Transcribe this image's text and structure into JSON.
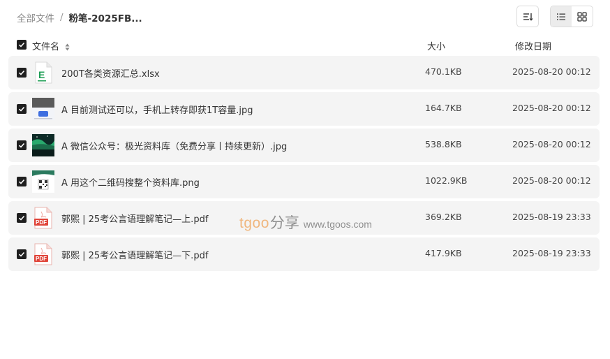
{
  "breadcrumb": {
    "root": "全部文件",
    "separator": "/",
    "current": "粉笔-2025FB..."
  },
  "toolbar": {
    "sort_icon": "sort-icon",
    "list_view_icon": "list-view-icon",
    "grid_view_icon": "grid-view-icon",
    "active_view": "list"
  },
  "table": {
    "headers": {
      "name": "文件名",
      "size": "大小",
      "date": "修改日期"
    },
    "rows": [
      {
        "name": "200T各类资源汇总.xlsx",
        "size": "470.1KB",
        "date": "2025-08-20 00:12",
        "icon": "excel-file-icon",
        "checked": true
      },
      {
        "name": "A 目前测试还可以，手机上转存即获1T容量.jpg",
        "size": "164.7KB",
        "date": "2025-08-20 00:12",
        "icon": "image-thumbnail",
        "checked": true
      },
      {
        "name": "A 微信公众号：极光资料库（免费分享丨持续更新）.jpg",
        "size": "538.8KB",
        "date": "2025-08-20 00:12",
        "icon": "image-thumbnail",
        "checked": true
      },
      {
        "name": "A 用这个二维码搜整个资料库.png",
        "size": "1022.9KB",
        "date": "2025-08-20 00:12",
        "icon": "qr-image-thumbnail",
        "checked": true
      },
      {
        "name": "郭熙 | 25考公言语理解笔记—上.pdf",
        "size": "369.2KB",
        "date": "2025-08-19 23:33",
        "icon": "pdf-file-icon",
        "checked": true
      },
      {
        "name": "郭熙 | 25考公言语理解笔记—下.pdf",
        "size": "417.9KB",
        "date": "2025-08-19 23:33",
        "icon": "pdf-file-icon",
        "checked": true
      }
    ]
  },
  "file_icons": {
    "excel_letter": "E",
    "pdf_label": "PDF"
  },
  "watermark": {
    "brand": "tgoo",
    "cn": "分享",
    "url": "www.tgoos.com"
  },
  "colors": {
    "row_bg": "#f4f4f4",
    "checkbox": "#1f1f1f",
    "excel_green": "#1e9e55",
    "pdf_red": "#e0453a",
    "watermark_orange": "#f0b77f"
  }
}
